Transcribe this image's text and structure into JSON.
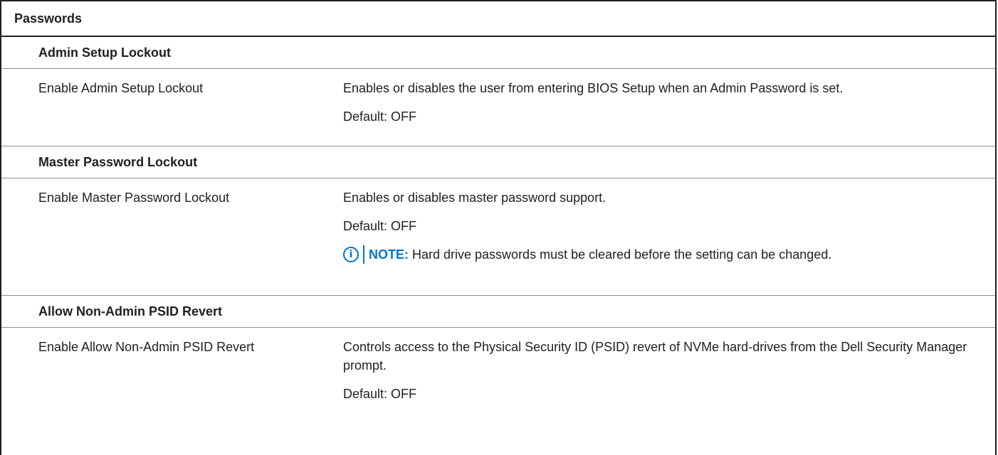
{
  "table_title": "Passwords",
  "sections": [
    {
      "heading": "Admin Setup Lockout",
      "option": "Enable Admin Setup Lockout",
      "description": "Enables or disables the user from entering BIOS Setup when an Admin Password is set.",
      "default": "Default: OFF"
    },
    {
      "heading": "Master Password Lockout",
      "option": "Enable Master Password Lockout",
      "description": "Enables or disables master password support.",
      "default": "Default: OFF",
      "note_label": "NOTE:",
      "note_text": " Hard drive passwords must be cleared before the setting can be changed.",
      "note_icon": "info-icon"
    },
    {
      "heading": "Allow Non-Admin PSID Revert",
      "option": "Enable Allow Non-Admin PSID Revert",
      "description": "Controls access to the Physical Security ID (PSID) revert of NVMe hard-drives from the Dell Security Manager prompt.",
      "default": "Default: OFF"
    }
  ],
  "colors": {
    "note_accent": "#0076ce",
    "border": "#1f1f1f",
    "row_divider": "#8c8c8c"
  }
}
